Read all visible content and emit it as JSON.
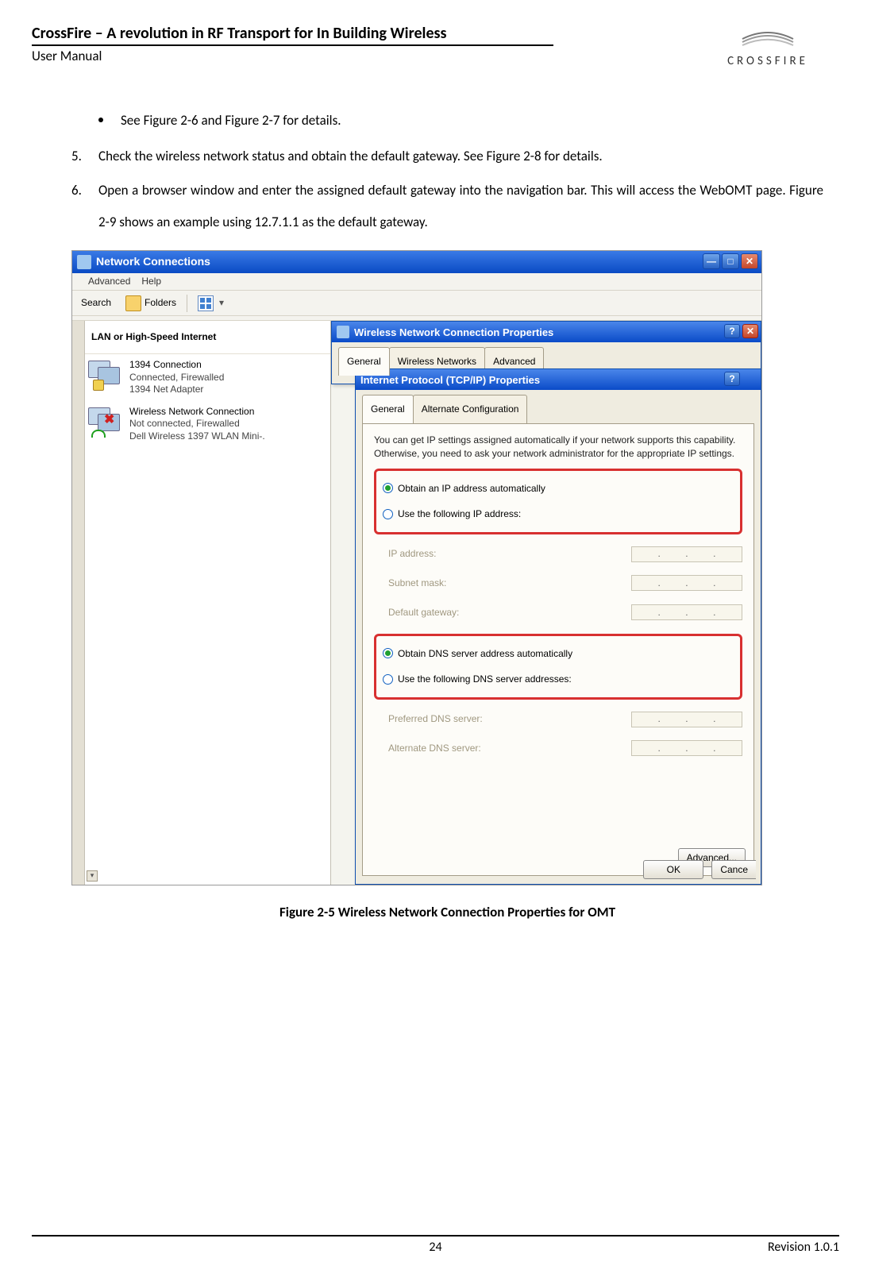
{
  "header": {
    "title": "CrossFire – A revolution in RF Transport for In Building Wireless",
    "subtitle": "User Manual",
    "logo_text": "CROSSFIRE"
  },
  "content": {
    "bullet": "See Figure 2-6 and Figure 2-7 for details.",
    "step5_num": "5.",
    "step5": "Check the wireless network status and obtain the default gateway. See Figure 2-8 for details.",
    "step6_num": "6.",
    "step6": "Open a browser window and enter the assigned default gateway into the navigation bar. This will access the WebOMT page. Figure 2-9 shows an example using 12.7.1.1 as the default gateway."
  },
  "screenshot": {
    "main_window": {
      "title": "Network Connections",
      "menu": {
        "advanced": "Advanced",
        "help": "Help"
      },
      "toolbar": {
        "search": "Search",
        "folders": "Folders"
      },
      "lan_header": "LAN or High-Speed Internet",
      "conn1": {
        "name": "1394 Connection",
        "line2": "Connected, Firewalled",
        "line3": "1394 Net Adapter"
      },
      "conn2": {
        "name": "Wireless Network Connection",
        "line2": "Not connected, Firewalled",
        "line3": "Dell Wireless 1397 WLAN Mini-."
      }
    },
    "wncp_dialog": {
      "title": "Wireless Network Connection Properties",
      "tabs": {
        "general": "General",
        "wireless": "Wireless Networks",
        "advanced": "Advanced"
      }
    },
    "tcp_dialog": {
      "title": "Internet Protocol (TCP/IP) Properties",
      "tabs": {
        "general": "General",
        "alt": "Alternate Configuration"
      },
      "info": "You can get IP settings assigned automatically if your network supports this capability. Otherwise, you need to ask your network administrator for the appropriate IP settings.",
      "radio_ip_auto": "Obtain an IP address automatically",
      "radio_ip_manual": "Use the following IP address:",
      "ip_address": "IP address:",
      "subnet": "Subnet mask:",
      "gateway": "Default gateway:",
      "radio_dns_auto": "Obtain DNS server address automatically",
      "radio_dns_manual": "Use the following DNS server addresses:",
      "pref_dns": "Preferred DNS server:",
      "alt_dns": "Alternate DNS server:",
      "advanced_btn": "Advanced...",
      "ok": "OK",
      "cancel": "Cance"
    }
  },
  "figure_caption": "Figure 2-5 Wireless Network Connection Properties for OMT",
  "footer": {
    "page": "24",
    "revision": "Revision 1.0.1"
  }
}
